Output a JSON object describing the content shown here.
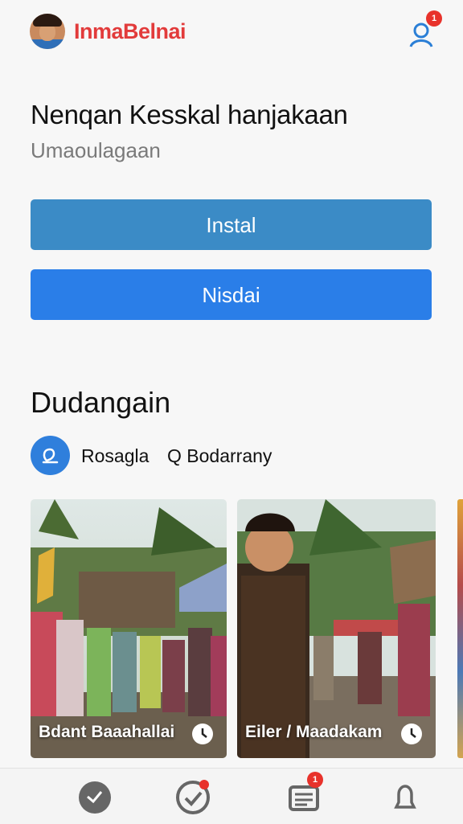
{
  "header": {
    "brand": "InmaBelnai",
    "notification_count": "1"
  },
  "hero": {
    "title": "Nenqan Kesskal hanjakaan",
    "subtitle": "Umaoulagaan",
    "install_label": "Instal",
    "secondary_label": "Nisdai"
  },
  "section": {
    "title": "Dudangain",
    "location_primary": "Rosagla",
    "location_secondary": "Q Bodarrany"
  },
  "cards": [
    {
      "caption": "Bdant Baaahallai"
    },
    {
      "caption": "Eiler / Maadakam"
    }
  ],
  "nav": {
    "badges": [
      "1"
    ]
  },
  "colors": {
    "brand": "#e23b3b",
    "primary_button": "#3b8bc6",
    "secondary_button": "#2a7ee8",
    "badge": "#e8322b"
  },
  "icons": [
    "user-icon",
    "location-pin-icon",
    "clock-icon",
    "home-icon",
    "check-icon",
    "document-icon",
    "bell-icon"
  ]
}
